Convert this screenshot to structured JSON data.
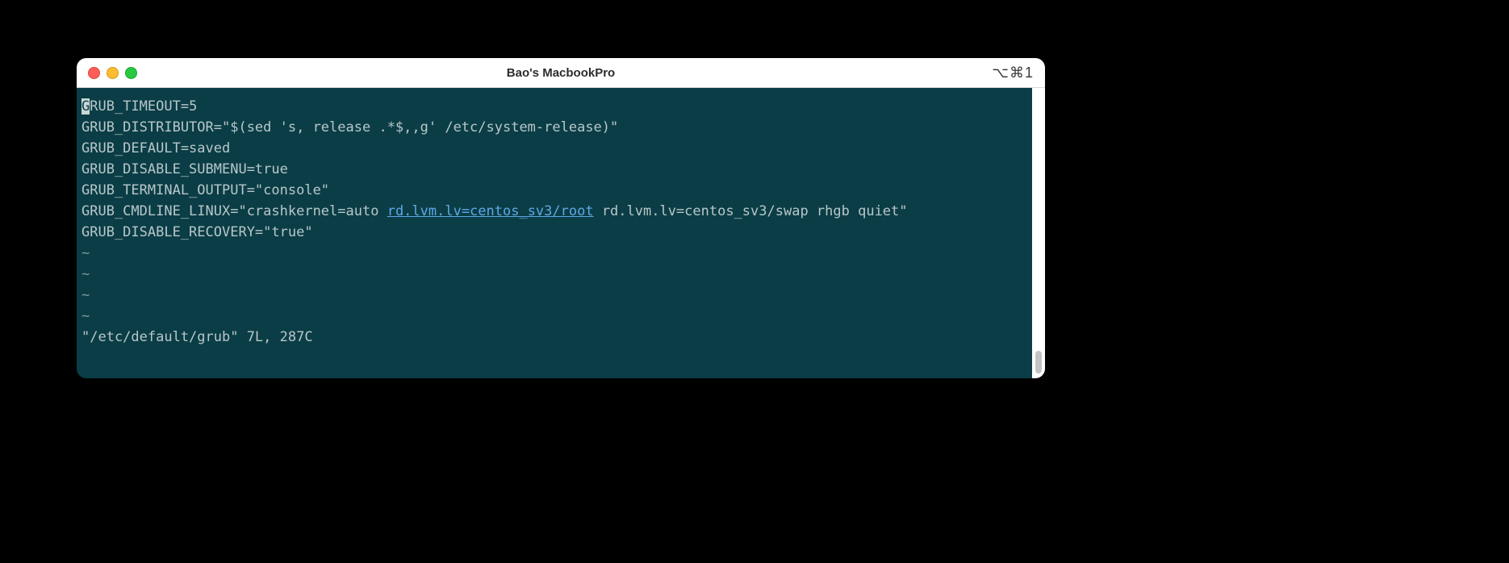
{
  "window": {
    "title": "Bao's MacbookPro",
    "shortcut": "⌥⌘1"
  },
  "editor": {
    "cursor_char": "G",
    "lines": {
      "l0_rest": "RUB_TIMEOUT=5",
      "l1": "GRUB_DISTRIBUTOR=\"$(sed 's, release .*$,,g' /etc/system-release)\"",
      "l2": "GRUB_DEFAULT=saved",
      "l3": "GRUB_DISABLE_SUBMENU=true",
      "l4": "GRUB_TERMINAL_OUTPUT=\"console\"",
      "l5_pre": "GRUB_CMDLINE_LINUX=\"crashkernel=auto ",
      "l5_link": "rd.lvm.lv=centos_sv3/root",
      "l5_post": " rd.lvm.lv=centos_sv3/swap rhgb quiet\"",
      "l6": "GRUB_DISABLE_RECOVERY=\"true\""
    },
    "empty_line_marker": "~",
    "empty_line_count": 4,
    "status": "\"/etc/default/grub\" 7L, 287C"
  }
}
